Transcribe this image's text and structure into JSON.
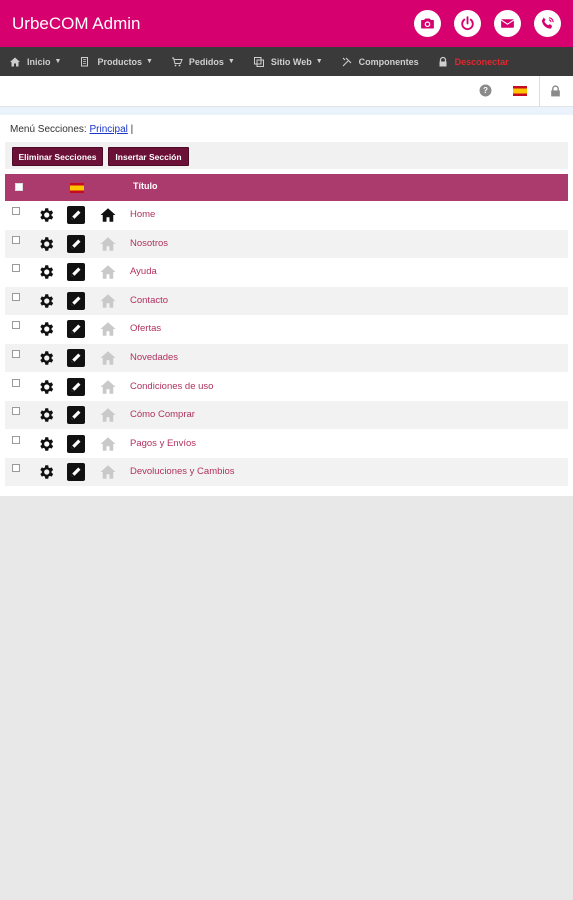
{
  "app": {
    "title": "UrbeCOM Admin"
  },
  "header_actions": [
    {
      "icon": "camera-icon"
    },
    {
      "icon": "power-icon"
    },
    {
      "icon": "mail-icon"
    },
    {
      "icon": "phone-icon"
    }
  ],
  "nav": {
    "inicio": "Inicio",
    "productos": "Productos",
    "pedidos": "Pedidos",
    "sitio_web": "Sitio Web",
    "componentes": "Componentes",
    "desconectar": "Desconectar"
  },
  "toolbar": {
    "help_icon": "help-icon",
    "language_icon": "spain-flag-icon",
    "lock_icon": "lock-icon"
  },
  "breadcrumb": {
    "prefix": "Menú Secciones:",
    "link": "Principal",
    "suffix": "|"
  },
  "buttons": {
    "delete": "Eliminar Secciones",
    "insert": "Insertar Sección"
  },
  "table": {
    "column_title": "Título",
    "rows": [
      {
        "title": "Home",
        "is_home": true
      },
      {
        "title": "Nosotros",
        "is_home": false
      },
      {
        "title": "Ayuda",
        "is_home": false
      },
      {
        "title": "Contacto",
        "is_home": false
      },
      {
        "title": "Ofertas",
        "is_home": false
      },
      {
        "title": "Novedades",
        "is_home": false
      },
      {
        "title": "Condiciones de uso",
        "is_home": false
      },
      {
        "title": "Cómo Comprar",
        "is_home": false
      },
      {
        "title": "Pagos y Envíos",
        "is_home": false
      },
      {
        "title": "Devoluciones y Cambios",
        "is_home": false
      }
    ]
  },
  "colors": {
    "accent": "#d6006e",
    "navbar": "#3a3a3a",
    "table_header": "#ac3b6d",
    "button": "#6b1036",
    "link_text": "#b0315f",
    "danger": "#e0282f"
  }
}
